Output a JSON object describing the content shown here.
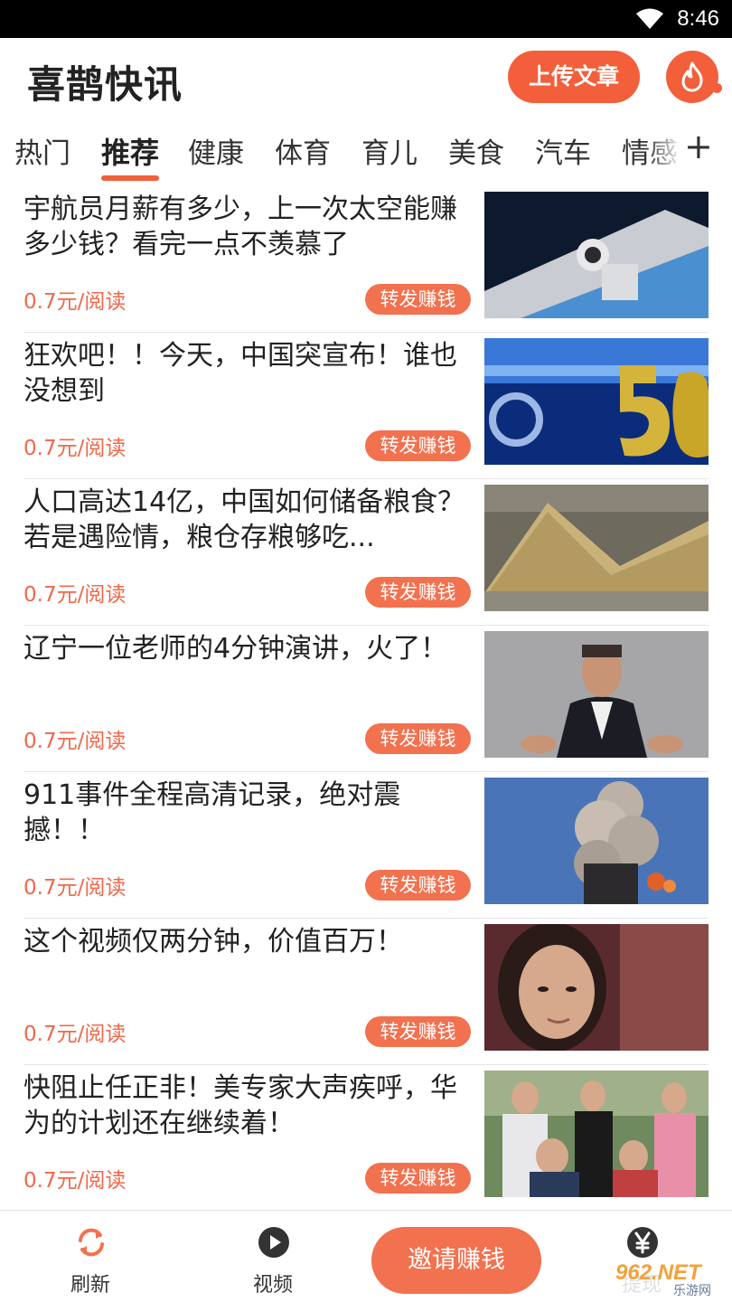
{
  "status_bar": {
    "time": "8:46",
    "wifi_icon": "wifi-icon"
  },
  "header": {
    "title": "喜鹊快讯",
    "upload_label": "上传文章",
    "fire_icon": "fire-icon",
    "accent_color": "#f25f3a"
  },
  "tabs": {
    "items": [
      "热门",
      "推荐",
      "健康",
      "体育",
      "育儿",
      "美食",
      "汽车",
      "情感"
    ],
    "active": "推荐",
    "add_label": "+"
  },
  "articles": [
    {
      "title": "宇航员月薪有多少，上一次太空能赚多少钱？看完一点不羡慕了",
      "rate": "0.7元/阅读",
      "share_label": "转发赚钱",
      "thumb": "astronaut-image"
    },
    {
      "title": "狂欢吧！！今天，中国突宣布！谁也没想到",
      "rate": "0.7元/阅读",
      "share_label": "转发赚钱",
      "thumb": "5g-image"
    },
    {
      "title": "人口高达14亿，中国如何储备粮食？若是遇险情，粮仓存粮够吃...",
      "rate": "0.7元/阅读",
      "share_label": "转发赚钱",
      "thumb": "grain-image"
    },
    {
      "title": "辽宁一位老师的4分钟演讲，火了！",
      "rate": "0.7元/阅读",
      "share_label": "转发赚钱",
      "thumb": "speaker-image"
    },
    {
      "title": "911事件全程高清记录，绝对震撼！！",
      "rate": "0.7元/阅读",
      "share_label": "转发赚钱",
      "thumb": "smoke-image"
    },
    {
      "title": "这个视频仅两分钟，价值百万！",
      "rate": "0.7元/阅读",
      "share_label": "转发赚钱",
      "thumb": "woman-image"
    },
    {
      "title": "快阻止任正非！美专家大声疾呼，华为的计划还在继续着！",
      "rate": "0.7元/阅读",
      "share_label": "转发赚钱",
      "thumb": "group-photo-image"
    }
  ],
  "bottom_nav": {
    "refresh_label": "刷新",
    "refresh_icon": "refresh-icon",
    "video_label": "视频",
    "video_icon": "play-icon",
    "invite_label": "邀请赚钱",
    "withdraw_label": "提现",
    "withdraw_icon": "yen-icon"
  },
  "watermark": {
    "text": "962.NET",
    "subtext": "乐游网"
  }
}
